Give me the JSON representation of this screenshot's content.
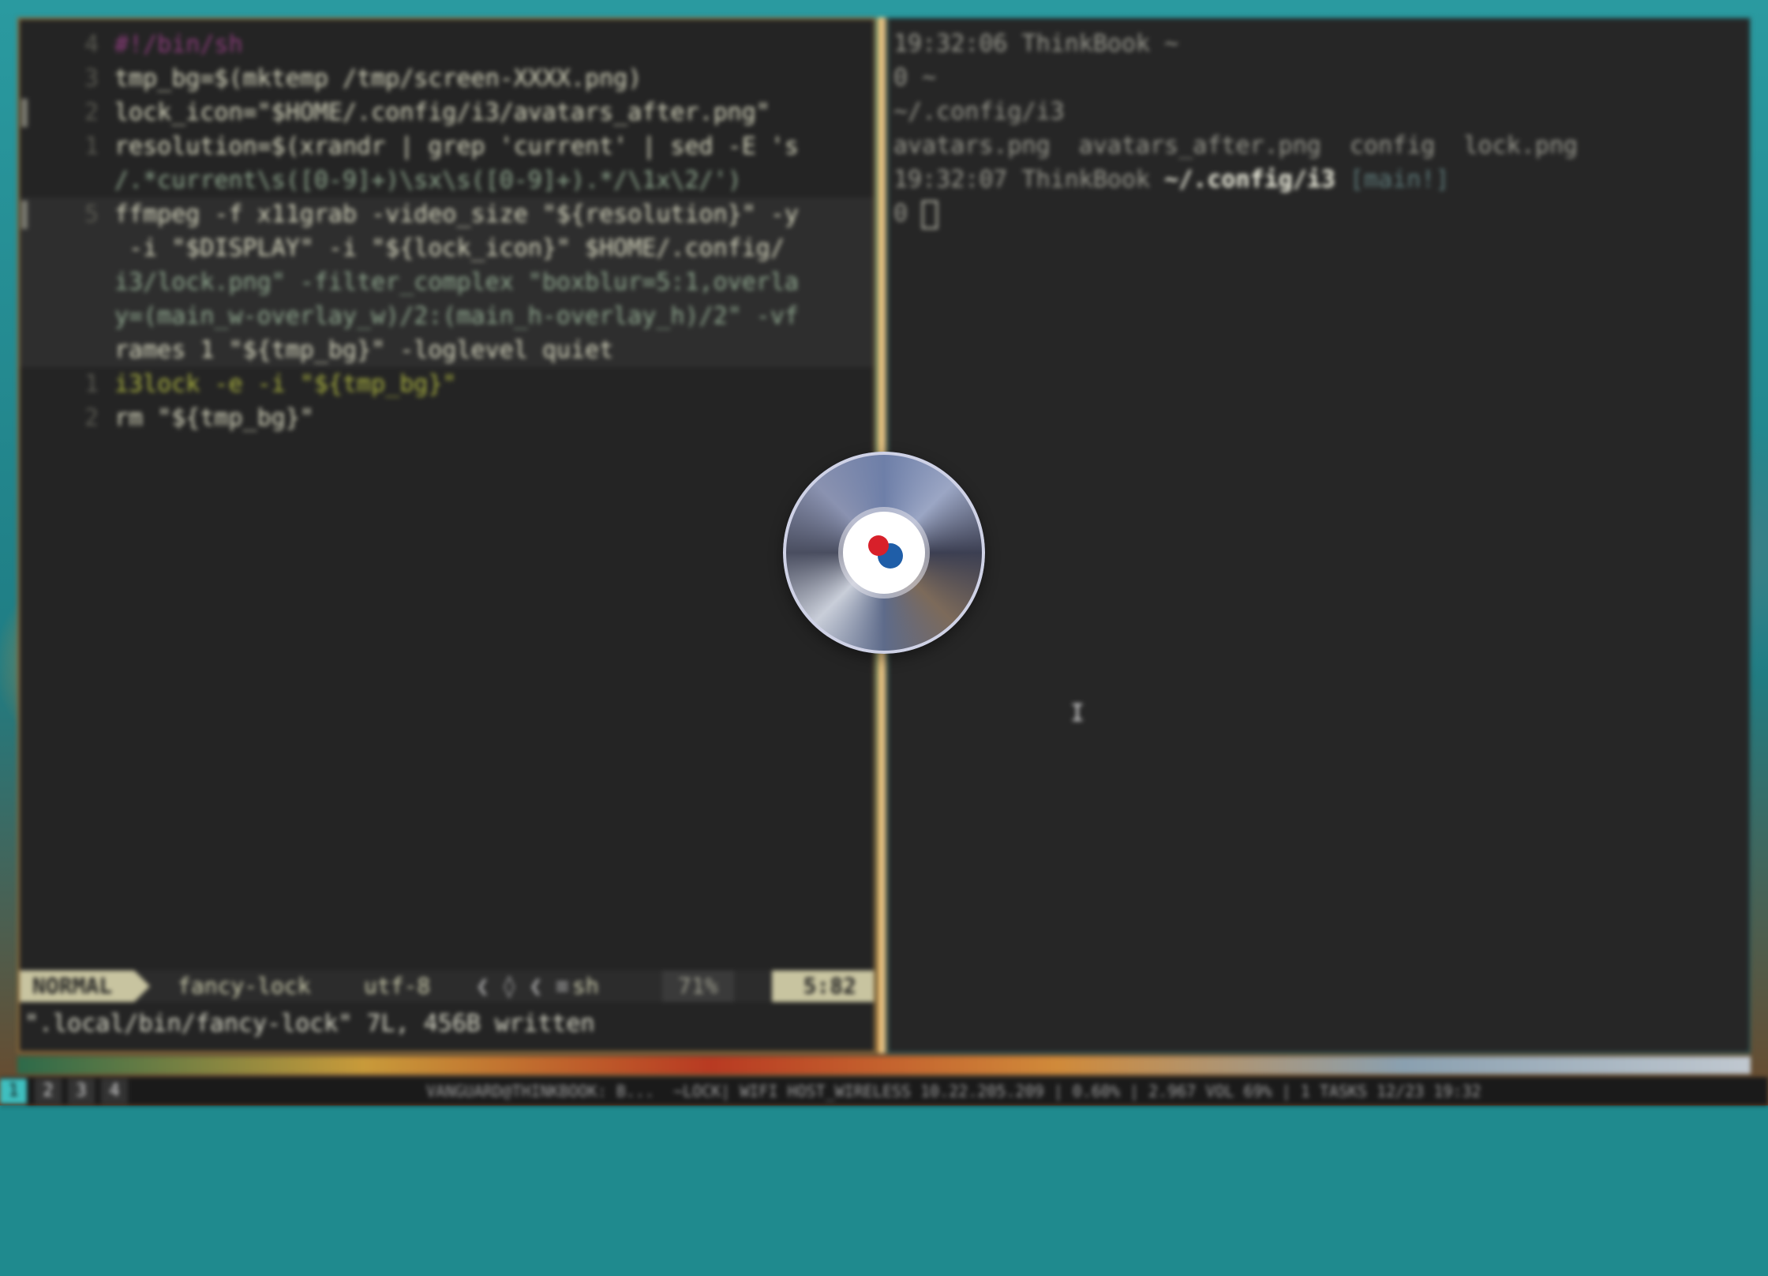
{
  "vim": {
    "lines": [
      {
        "num": "4",
        "text": "#!/bin/sh"
      },
      {
        "num": "3",
        "text": "tmp_bg=$(mktemp /tmp/screen-XXXX.png)"
      },
      {
        "num": "2",
        "text": "lock_icon=\"$HOME/.config/i3/avatars_after.png\""
      },
      {
        "num": "1",
        "text": "resolution=$(xrandr | grep 'current' | sed -E 's"
      },
      {
        "num": "",
        "text": "/.*current\\s([0-9]+)\\sx\\s([0-9]+).*/\\1x\\2/')"
      },
      {
        "num": "5",
        "text": "ffmpeg -f x11grab -video_size \"${resolution}\" -y"
      },
      {
        "num": "",
        "text": " -i \"$DISPLAY\" -i \"${lock_icon}\" $HOME/.config/"
      },
      {
        "num": "",
        "text": "i3/lock.png\" -filter_complex \"boxblur=5:1,overla"
      },
      {
        "num": "",
        "text": "y=(main_w-overlay_w)/2:(main_h-overlay_h)/2\" -vf"
      },
      {
        "num": "",
        "text": "rames 1 \"${tmp_bg}\" -loglevel quiet"
      },
      {
        "num": "1",
        "text": "i3lock -e -i \"${tmp_bg}\""
      },
      {
        "num": "2",
        "text": "rm \"${tmp_bg}\""
      }
    ],
    "status": {
      "mode": "NORMAL",
      "file": "fancy-lock",
      "encoding": "utf-8",
      "separators": "❮ ◊ ❮ ≡",
      "filetype": "sh",
      "percent": "71%",
      "position": "5:82"
    },
    "cmdline": "\".local/bin/fancy-lock\" 7L, 456B written"
  },
  "terminal": {
    "lines": [
      "19:32:06 ThinkBook ~",
      "0 ~",
      "~/.config/i3",
      "avatars.png  avatars_after.png  config  lock.png"
    ],
    "prompt_time": "19:32:07 ThinkBook",
    "prompt_path": "~/.config/i3",
    "prompt_branch": "[main!]",
    "prompt_symbol": "0"
  },
  "bar": {
    "workspaces": [
      "1",
      "2",
      "3",
      "4"
    ],
    "status_text": "VANGUARD@THINKBOOK: B...  ~LOCK| WIFI HOST_WIRELESS 10.22.205.209 | 0.60% | 2.967 VOL 69% | 1 TASKS 12/23 19:32"
  },
  "colors": {
    "accent": "#3fbfbf",
    "vim_mode_bg": "#c8c4a0",
    "border": "#8a6a3a"
  }
}
